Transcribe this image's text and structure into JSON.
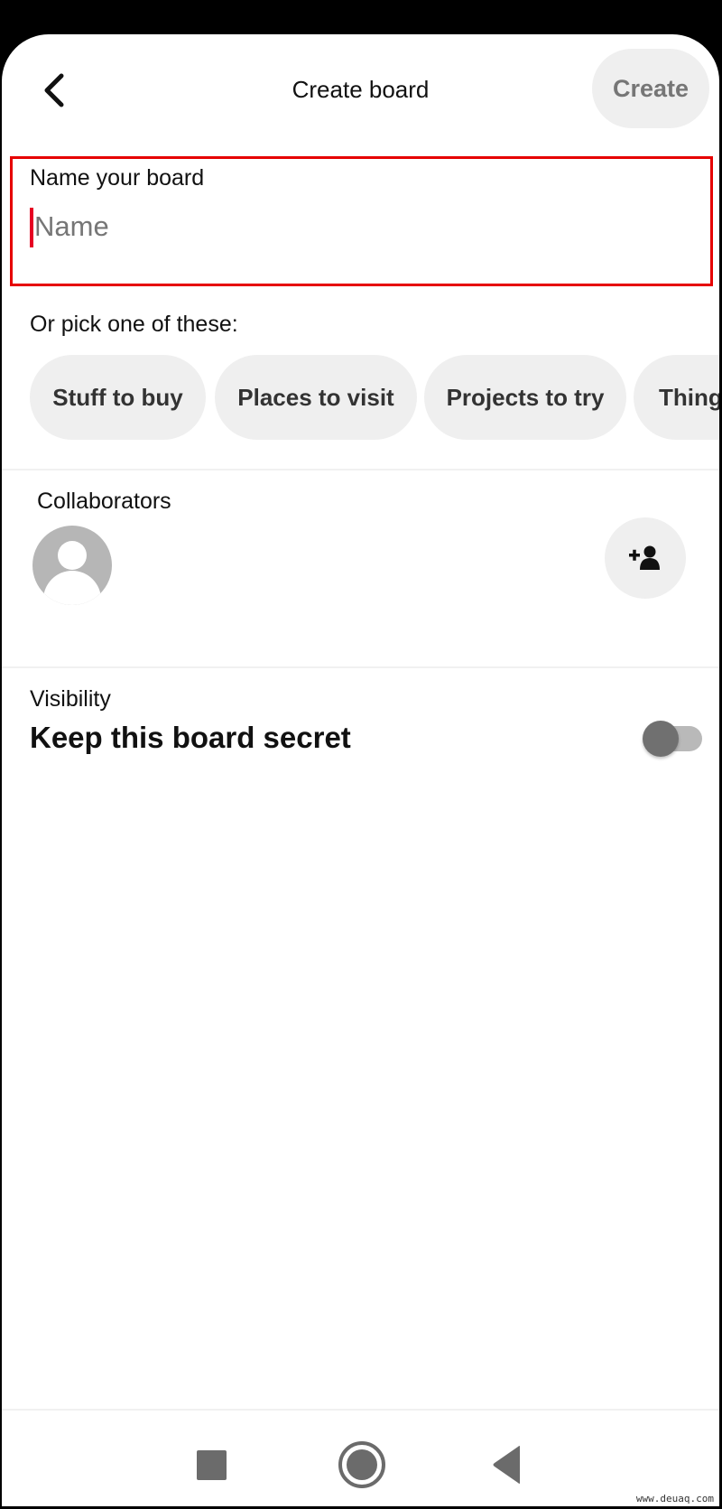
{
  "header": {
    "title": "Create board",
    "create_label": "Create",
    "back_icon": "chevron-left-icon"
  },
  "name_field": {
    "label": "Name your board",
    "placeholder": "Name",
    "value": ""
  },
  "suggestions": {
    "label": "Or pick one of these:",
    "chips": [
      {
        "label": "Stuff to buy"
      },
      {
        "label": "Places to visit"
      },
      {
        "label": "Projects to try"
      },
      {
        "label": "Things"
      }
    ]
  },
  "collaborators": {
    "label": "Collaborators",
    "avatar_icon": "default-avatar-icon",
    "add_icon": "add-person-icon"
  },
  "visibility": {
    "label": "Visibility",
    "secret_label": "Keep this board secret",
    "secret_enabled": false
  },
  "nav_bar": {
    "icons": [
      "recents-square-icon",
      "home-circle-icon",
      "back-triangle-icon"
    ]
  },
  "colors": {
    "accent": "#e60023",
    "highlight_border": "#e60000",
    "chip_bg": "#efefef",
    "toggle_thumb": "#707070",
    "toggle_track": "#b9b9b9"
  },
  "watermark": "www.deuaq.com"
}
